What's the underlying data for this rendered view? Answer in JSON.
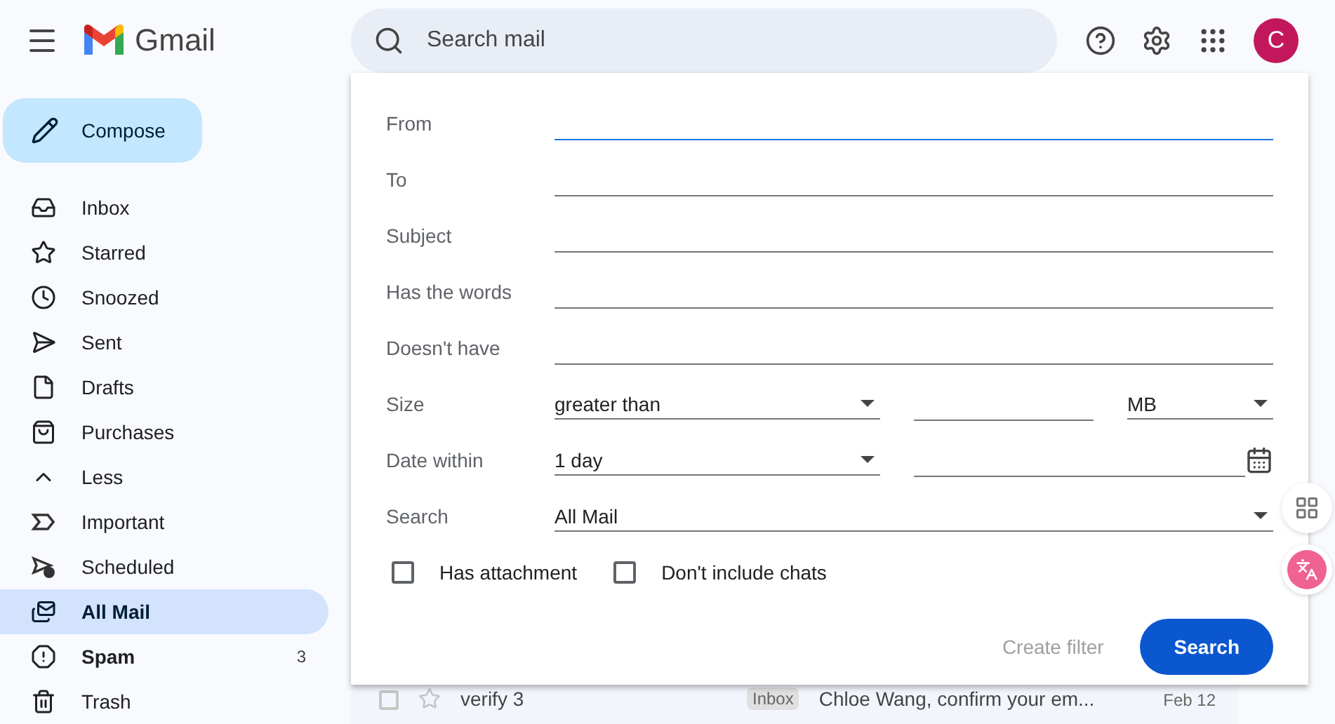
{
  "logo": {
    "text": "Gmail"
  },
  "compose": {
    "label": "Compose"
  },
  "folders": [
    {
      "label": "Inbox",
      "selected": false,
      "unread": false
    },
    {
      "label": "Starred",
      "selected": false,
      "unread": false
    },
    {
      "label": "Snoozed",
      "selected": false,
      "unread": false
    },
    {
      "label": "Sent",
      "selected": false,
      "unread": false
    },
    {
      "label": "Drafts",
      "selected": false,
      "unread": false
    },
    {
      "label": "Purchases",
      "selected": false,
      "unread": false
    },
    {
      "label": "Less",
      "selected": false,
      "unread": false
    },
    {
      "label": "Important",
      "selected": false,
      "unread": false
    },
    {
      "label": "Scheduled",
      "selected": false,
      "unread": false
    },
    {
      "label": "All Mail",
      "selected": true,
      "unread": false
    },
    {
      "label": "Spam",
      "selected": false,
      "unread": true,
      "count": "3"
    },
    {
      "label": "Trash",
      "selected": false,
      "unread": false
    }
  ],
  "search": {
    "placeholder": "Search mail"
  },
  "account": {
    "initial": "C"
  },
  "filter": {
    "rows": [
      {
        "kind": "text",
        "label": "From",
        "focused": true
      },
      {
        "kind": "text",
        "label": "To",
        "focused": false
      },
      {
        "kind": "text",
        "label": "Subject",
        "focused": false
      },
      {
        "kind": "text",
        "label": "Has the words",
        "focused": false
      },
      {
        "kind": "text",
        "label": "Doesn't have",
        "focused": false
      },
      {
        "kind": "size",
        "label": "Size",
        "operator": "greater than",
        "unit": "MB"
      },
      {
        "kind": "date",
        "label": "Date within",
        "range": "1 day"
      },
      {
        "kind": "select",
        "label": "Search",
        "value": "All Mail"
      }
    ],
    "checkboxes": [
      {
        "label": "Has attachment",
        "checked": false
      },
      {
        "label": "Don't include chats",
        "checked": false
      }
    ],
    "create_filter": {
      "label": "Create filter",
      "disabled": true
    },
    "search_button": {
      "label": "Search"
    }
  },
  "emails": [
    {
      "sender": "verify",
      "count": "3",
      "tag": "Inbox",
      "subject": "Chloe Wang, confirm your em...",
      "date": "Feb 12",
      "checked": false,
      "starred": false
    }
  ]
}
